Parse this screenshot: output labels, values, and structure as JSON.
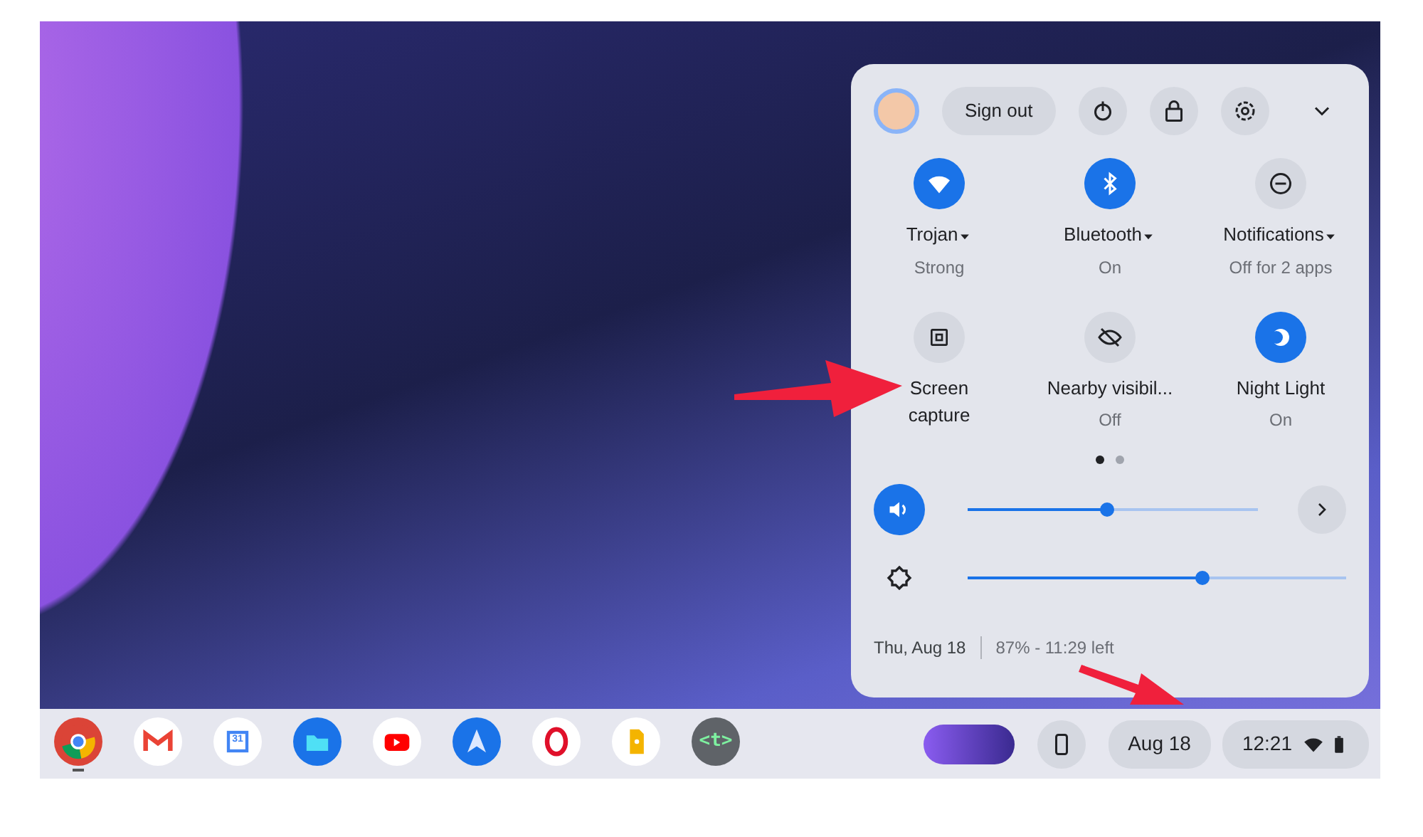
{
  "quick_settings": {
    "header": {
      "sign_out": "Sign out"
    },
    "tiles": [
      {
        "kind": "wifi",
        "label": "Trojan",
        "sublabel": "Strong",
        "on": true,
        "dropdown": true
      },
      {
        "kind": "bluetooth",
        "label": "Bluetooth",
        "sublabel": "On",
        "on": true,
        "dropdown": true
      },
      {
        "kind": "notifications",
        "label": "Notifications",
        "sublabel": "Off for 2 apps",
        "on": false,
        "dropdown": true
      },
      {
        "kind": "screen_capture",
        "label": "Screen\ncapture",
        "on": false,
        "dropdown": false
      },
      {
        "kind": "nearby",
        "label": "Nearby visibil...",
        "sublabel": "Off",
        "on": false,
        "dropdown": false
      },
      {
        "kind": "night_light",
        "label": "Night Light",
        "sublabel": "On",
        "on": true,
        "dropdown": false
      }
    ],
    "pages": [
      {
        "selected": true
      },
      {
        "selected": false
      }
    ],
    "sliders": [
      {
        "kind": "volume",
        "level": 0.48,
        "on": true
      },
      {
        "kind": "brightness",
        "level": 0.62,
        "on": false
      }
    ],
    "footer": {
      "date": "Thu, Aug 18",
      "battery": "87% - 11:29 left"
    }
  },
  "shelf": {
    "apps": [
      {
        "kind": "chrome",
        "running": true
      },
      {
        "kind": "gmail",
        "running": false
      },
      {
        "kind": "calendar",
        "label": "31",
        "running": false
      },
      {
        "kind": "files",
        "running": false
      },
      {
        "kind": "youtube",
        "running": false
      },
      {
        "kind": "spark",
        "running": false
      },
      {
        "kind": "opera",
        "running": false
      },
      {
        "kind": "keep",
        "running": false
      },
      {
        "kind": "terminal",
        "label": "<t>",
        "running": false
      }
    ],
    "date": "Aug 18",
    "time": "12:21"
  }
}
